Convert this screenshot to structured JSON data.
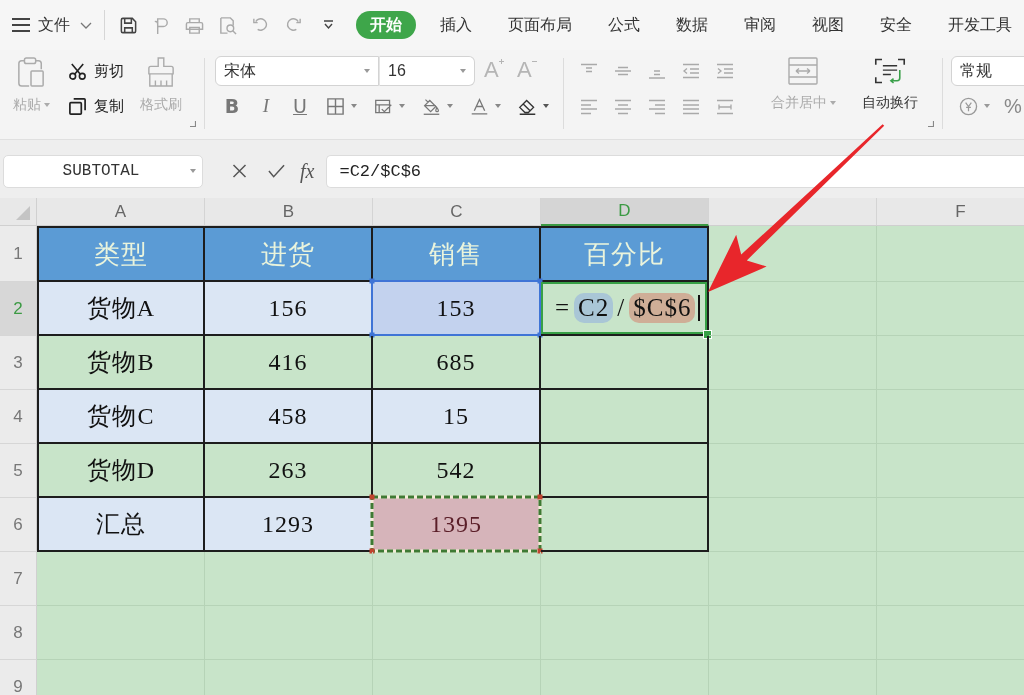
{
  "menu_bar": {
    "file_menu": {
      "label": "文件"
    },
    "tabs": [
      {
        "label": "开始",
        "selected": true
      },
      {
        "label": "插入",
        "selected": false
      },
      {
        "label": "页面布局",
        "selected": false
      },
      {
        "label": "公式",
        "selected": false
      },
      {
        "label": "数据",
        "selected": false
      },
      {
        "label": "审阅",
        "selected": false
      },
      {
        "label": "视图",
        "selected": false
      },
      {
        "label": "安全",
        "selected": false
      },
      {
        "label": "开发工具",
        "selected": false
      }
    ]
  },
  "ribbon": {
    "clipboard": {
      "paste": {
        "label": "粘贴",
        "disabled": true
      },
      "cut": {
        "label": "剪切",
        "disabled": false
      },
      "copy": {
        "label": "复制",
        "disabled": false
      },
      "format_painter": {
        "label": "格式刷",
        "disabled": true
      }
    },
    "font": {
      "name": {
        "value": "宋体"
      },
      "size": {
        "value": "16"
      },
      "size_buttons": [
        {
          "kind": "grow",
          "label": "A",
          "disabled": true
        },
        {
          "kind": "shrink",
          "label": "A",
          "disabled": true
        }
      ],
      "style_buttons": [
        {
          "kind": "bold",
          "label": "B"
        },
        {
          "kind": "italic",
          "label": "I"
        },
        {
          "kind": "underline",
          "label": "U"
        }
      ]
    },
    "alignment": {
      "disabled": true
    },
    "merge_center": {
      "label": "合并居中",
      "disabled": true
    },
    "wrap_text": {
      "label": "自动换行",
      "disabled": false
    },
    "number": {
      "format": {
        "value": "常规"
      },
      "percent_button": {
        "label": "%"
      }
    }
  },
  "formula_bar": {
    "name_box": {
      "value": "SUBTOTAL"
    },
    "function_button": {
      "label": "fx"
    },
    "formula": {
      "value": "=C2/$C$6"
    }
  },
  "sheet": {
    "columns": [
      {
        "label": "A",
        "selected": false
      },
      {
        "label": "B",
        "selected": false
      },
      {
        "label": "C",
        "selected": false
      },
      {
        "label": "D",
        "selected": true
      },
      {
        "selected": false
      },
      {
        "label": "F",
        "selected": false
      }
    ],
    "rows": [
      {
        "label": "1",
        "selected": false,
        "kind": "header",
        "cells": [
          {
            "kind": "text",
            "text": "类型"
          },
          {
            "kind": "text",
            "text": "进货"
          },
          {
            "kind": "text",
            "text": "销售"
          },
          {
            "kind": "text",
            "text": "百分比"
          }
        ]
      },
      {
        "label": "2",
        "selected": true,
        "kind": "band",
        "cells": [
          {
            "kind": "text",
            "text": "货物A"
          },
          {
            "kind": "text",
            "text": "156"
          },
          {
            "kind": "reference",
            "text": "153",
            "color": "#c3d2ee"
          },
          {
            "kind": "editing",
            "parts": [
              {
                "kind": "operator",
                "text": "="
              },
              {
                "kind": "reference",
                "text": "C2",
                "color": "#a9c6d6"
              },
              {
                "kind": "operator",
                "text": "/"
              },
              {
                "kind": "reference",
                "text": "$C$6",
                "color": "#cfae97"
              }
            ]
          }
        ]
      },
      {
        "label": "3",
        "selected": false,
        "kind": "plain",
        "cells": [
          {
            "kind": "text",
            "text": "货物B"
          },
          {
            "kind": "text",
            "text": "416"
          },
          {
            "kind": "text",
            "text": "685"
          }
        ]
      },
      {
        "label": "4",
        "selected": false,
        "kind": "band",
        "cells": [
          {
            "kind": "text",
            "text": "货物C"
          },
          {
            "kind": "text",
            "text": "458"
          },
          {
            "kind": "text",
            "text": "15"
          }
        ]
      },
      {
        "label": "5",
        "selected": false,
        "kind": "plain",
        "cells": [
          {
            "kind": "text",
            "text": "货物D"
          },
          {
            "kind": "text",
            "text": "263"
          },
          {
            "kind": "text",
            "text": "542"
          }
        ]
      },
      {
        "label": "6",
        "selected": false,
        "kind": "band",
        "cells": [
          {
            "kind": "text",
            "text": "汇总"
          },
          {
            "kind": "text",
            "text": "1293"
          },
          {
            "kind": "marquee",
            "text": "1395",
            "color": "#d6b4ba"
          }
        ]
      },
      {
        "label": "7",
        "selected": false
      },
      {
        "label": "8",
        "selected": false
      },
      {
        "label": "9",
        "selected": false
      }
    ]
  }
}
